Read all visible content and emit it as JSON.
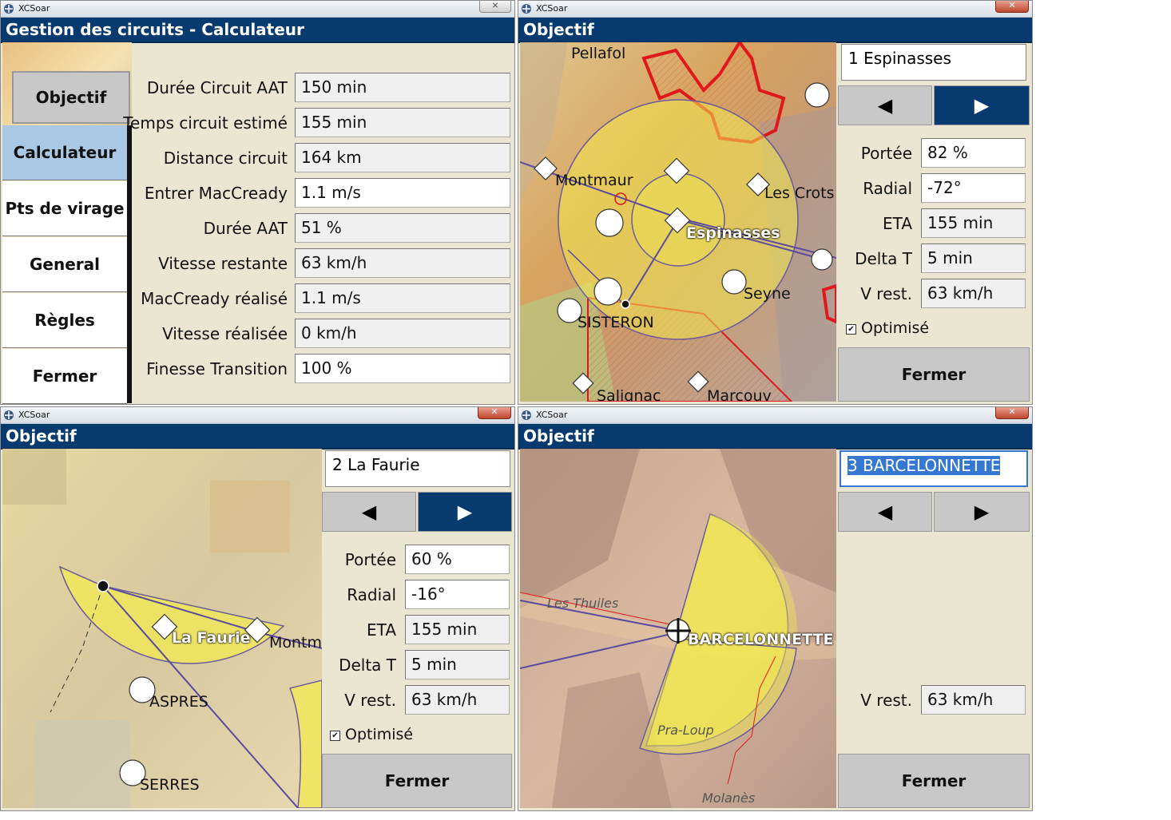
{
  "app_title": "XCSoar",
  "win1": {
    "caption": "Gestion des circuits - Calculateur",
    "nav": [
      "Objectif",
      "Calculateur",
      "Pts de virage",
      "General",
      "Règles",
      "Fermer"
    ],
    "rows": [
      {
        "label": "Durée Circuit AAT",
        "value": "150 min"
      },
      {
        "label": "Temps circuit estimé",
        "value": "155 min"
      },
      {
        "label": "Distance circuit",
        "value": "164 km"
      },
      {
        "label": "Entrer MacCready",
        "value": "1.1 m/s"
      },
      {
        "label": "Durée AAT",
        "value": "51 %"
      },
      {
        "label": "Vitesse restante",
        "value": "63 km/h"
      },
      {
        "label": "MacCready réalisé",
        "value": "1.1 m/s"
      },
      {
        "label": "Vitesse réalisée",
        "value": "0 km/h"
      },
      {
        "label": "Finesse Transition",
        "value": "100 %"
      }
    ]
  },
  "win2": {
    "caption": "Objectif",
    "waypoint": "1 Espinasses",
    "prev": "◀",
    "next": "▶",
    "rows": [
      {
        "label": "Portée",
        "value": "82 %"
      },
      {
        "label": "Radial",
        "value": "-72°"
      },
      {
        "label": "ETA",
        "value": "155 min"
      },
      {
        "label": "Delta T",
        "value": "5 min"
      },
      {
        "label": "V rest.",
        "value": "63 km/h"
      }
    ],
    "optimise": "Optimisé",
    "close": "Fermer",
    "map_labels": [
      "Pellafol",
      "Montmaur",
      "Les Crots",
      "Espinasses",
      "Seyne",
      "SISTERON",
      "Saliqnac",
      "Marcouv"
    ]
  },
  "win3": {
    "caption": "Objectif",
    "waypoint": "2 La Faurie",
    "prev": "◀",
    "next": "▶",
    "rows": [
      {
        "label": "Portée",
        "value": "60 %"
      },
      {
        "label": "Radial",
        "value": "-16°"
      },
      {
        "label": "ETA",
        "value": "155 min"
      },
      {
        "label": "Delta T",
        "value": "5 min"
      },
      {
        "label": "V rest.",
        "value": "63 km/h"
      }
    ],
    "optimise": "Optimisé",
    "close": "Fermer",
    "map_labels": [
      "La Faurie",
      "Montma",
      "ASPRES",
      "SERRES"
    ]
  },
  "win4": {
    "caption": "Objectif",
    "waypoint": "3 BARCELONNETTE",
    "prev": "◀",
    "next": "▶",
    "rows": [
      {
        "label": "V rest.",
        "value": "63 km/h"
      }
    ],
    "close": "Fermer",
    "map_labels": [
      "Les Thuiles",
      "BARCELONNETTE",
      "Pra-Loup",
      "Molanès"
    ]
  },
  "colors": {
    "caption_bg": "#073a6e",
    "selected_nav": "#aac8e4",
    "panel_bg": "#eae6d2",
    "sector": "#f2ea50",
    "airspace": "#e0181c"
  }
}
